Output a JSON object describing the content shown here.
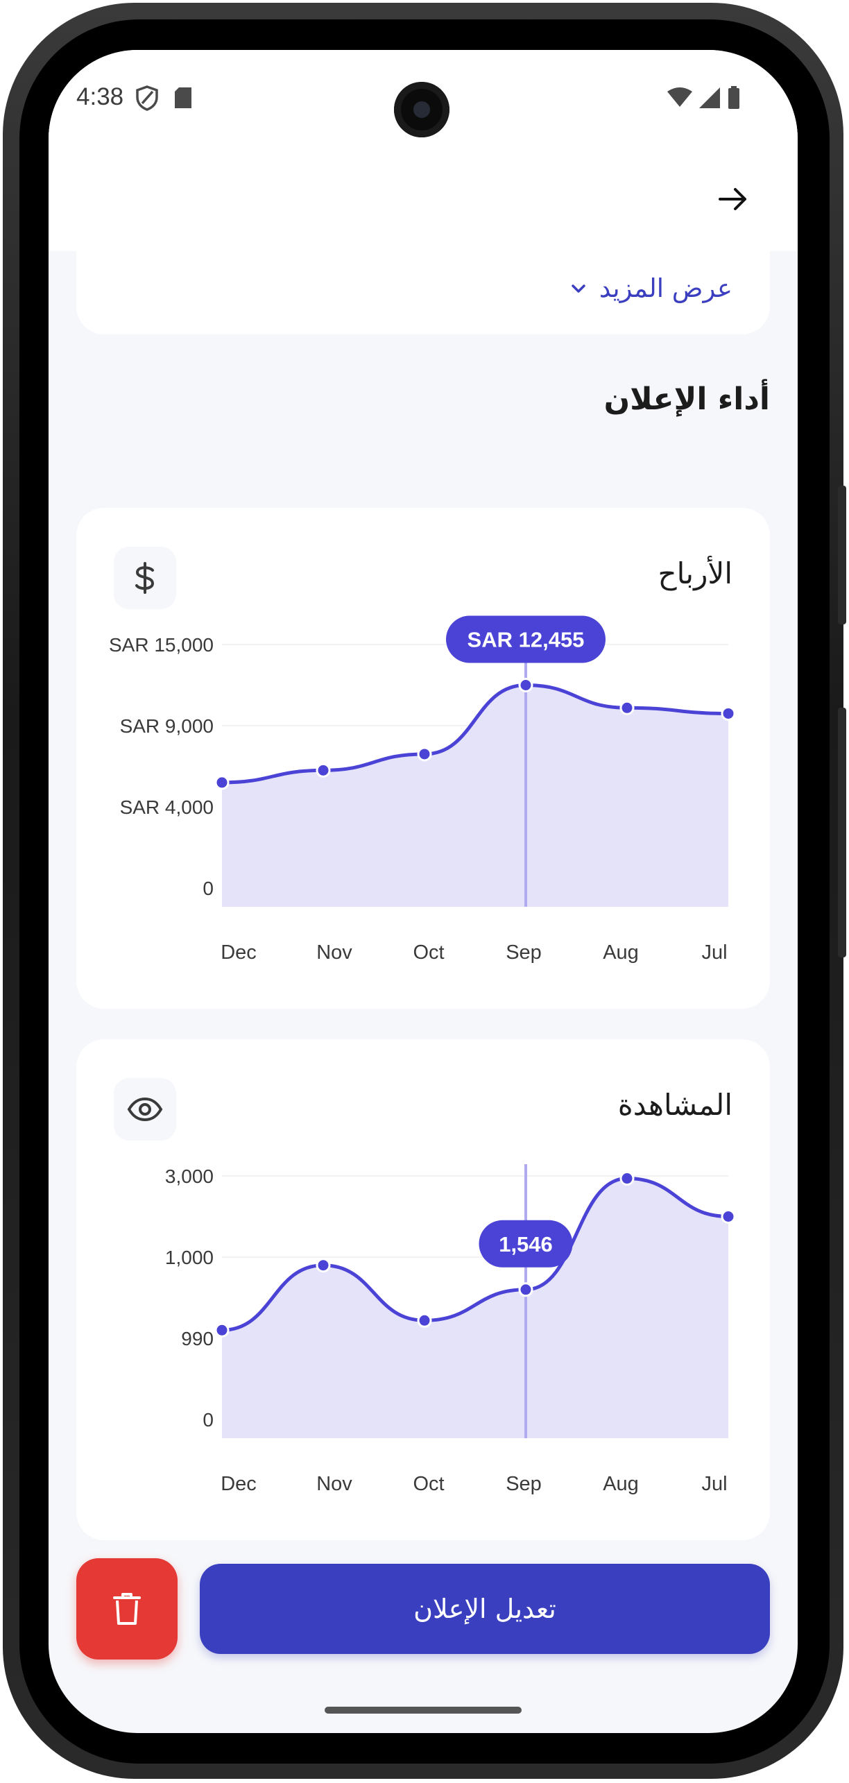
{
  "status_bar": {
    "time": "4:38"
  },
  "show_more": {
    "label": "عرض المزيد"
  },
  "section_title": "أداء الإعلان",
  "profit_card": {
    "title": "الأرباح",
    "icon": "dollar-icon"
  },
  "views_card": {
    "title": "المشاهدة",
    "icon": "eye-icon"
  },
  "actions": {
    "edit_label": "تعديل الإعلان",
    "delete_icon": "trash-icon"
  },
  "colors": {
    "accent": "#3a3fbf",
    "line": "#4b43d6",
    "fill": "#e5e3f9",
    "danger": "#e53935"
  },
  "chart_data": [
    {
      "type": "area",
      "categories": [
        "Dec",
        "Nov",
        "Oct",
        "Sep",
        "Aug",
        "Jul"
      ],
      "y_ticks": [
        "SAR 15,000",
        "SAR 9,000",
        "SAR 4,000",
        "0"
      ],
      "y_levels": [
        3,
        2,
        1,
        0
      ],
      "levels": [
        1.3,
        1.45,
        1.65,
        2.5,
        2.22,
        2.15
      ],
      "highlight": {
        "index": 3,
        "label": "SAR 12,455"
      },
      "grid": true
    },
    {
      "type": "area",
      "categories": [
        "Dec",
        "Nov",
        "Oct",
        "Sep",
        "Aug",
        "Jul"
      ],
      "y_ticks": [
        "3,000",
        "1,000",
        "990",
        "0"
      ],
      "y_levels": [
        3,
        2,
        1,
        0
      ],
      "levels": [
        1.1,
        1.9,
        1.22,
        1.6,
        2.97,
        2.5
      ],
      "highlight": {
        "index": 3,
        "label": "1,546"
      },
      "grid": true
    }
  ]
}
